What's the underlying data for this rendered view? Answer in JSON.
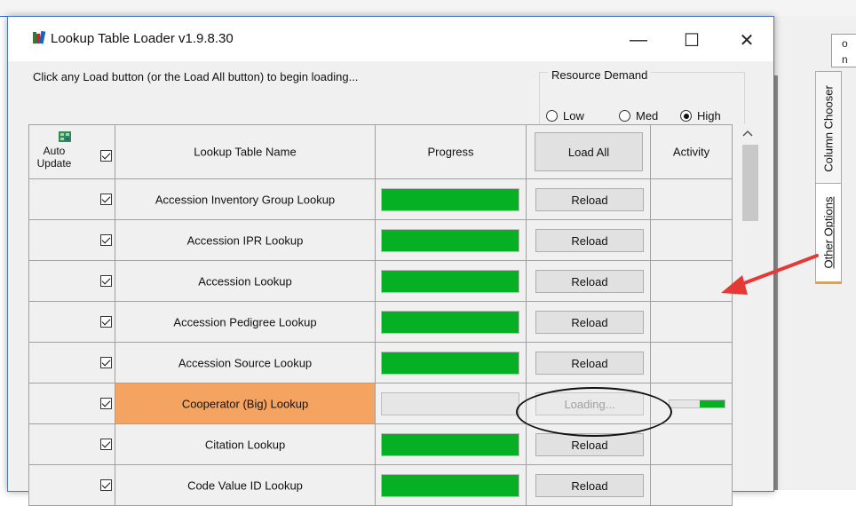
{
  "window": {
    "title": "Lookup Table Loader v1.9.8.30",
    "minimize_glyph": "—",
    "maximize_glyph": "☐",
    "close_glyph": "✕"
  },
  "instruction": "Click any Load button (or the Load All button) to begin loading...",
  "resource_demand": {
    "label": "Resource Demand",
    "options": [
      "Low",
      "Med",
      "High"
    ],
    "selected": "High"
  },
  "grid": {
    "headers": {
      "auto_update": "Auto Update",
      "name": "Lookup Table Name",
      "progress": "Progress",
      "load_all": "Load All",
      "activity": "Activity"
    },
    "rows": [
      {
        "name": "Accession Inventory Group Lookup",
        "auto_update": true,
        "progress": 1.0,
        "button": "Reload",
        "state": "done"
      },
      {
        "name": "Accession IPR Lookup",
        "auto_update": true,
        "progress": 1.0,
        "button": "Reload",
        "state": "done"
      },
      {
        "name": "Accession Lookup",
        "auto_update": true,
        "progress": 1.0,
        "button": "Reload",
        "state": "done"
      },
      {
        "name": "Accession Pedigree Lookup",
        "auto_update": true,
        "progress": 1.0,
        "button": "Reload",
        "state": "done"
      },
      {
        "name": "Accession Source Lookup",
        "auto_update": true,
        "progress": 1.0,
        "button": "Reload",
        "state": "done"
      },
      {
        "name": "Cooperator (Big) Lookup",
        "auto_update": true,
        "progress": 0.0,
        "button": "Loading...",
        "state": "loading",
        "activity": 0.45
      },
      {
        "name": "Citation Lookup",
        "auto_update": true,
        "progress": 1.0,
        "button": "Reload",
        "state": "done"
      },
      {
        "name": "Code Value ID Lookup",
        "auto_update": true,
        "progress": 1.0,
        "button": "Reload",
        "state": "done"
      }
    ]
  },
  "side_tabs": [
    "Column Chooser",
    "Other Options"
  ],
  "background_text": [
    "o",
    "n"
  ],
  "colors": {
    "progress_green": "#06b025",
    "loading_highlight": "#f4a460",
    "other_options_underline": "#f0a030",
    "arrow": "#e53935"
  },
  "icons": {
    "app": "books-icon",
    "auto_update": "grid-refresh-icon",
    "scroll_up": "chevron-up-icon"
  }
}
